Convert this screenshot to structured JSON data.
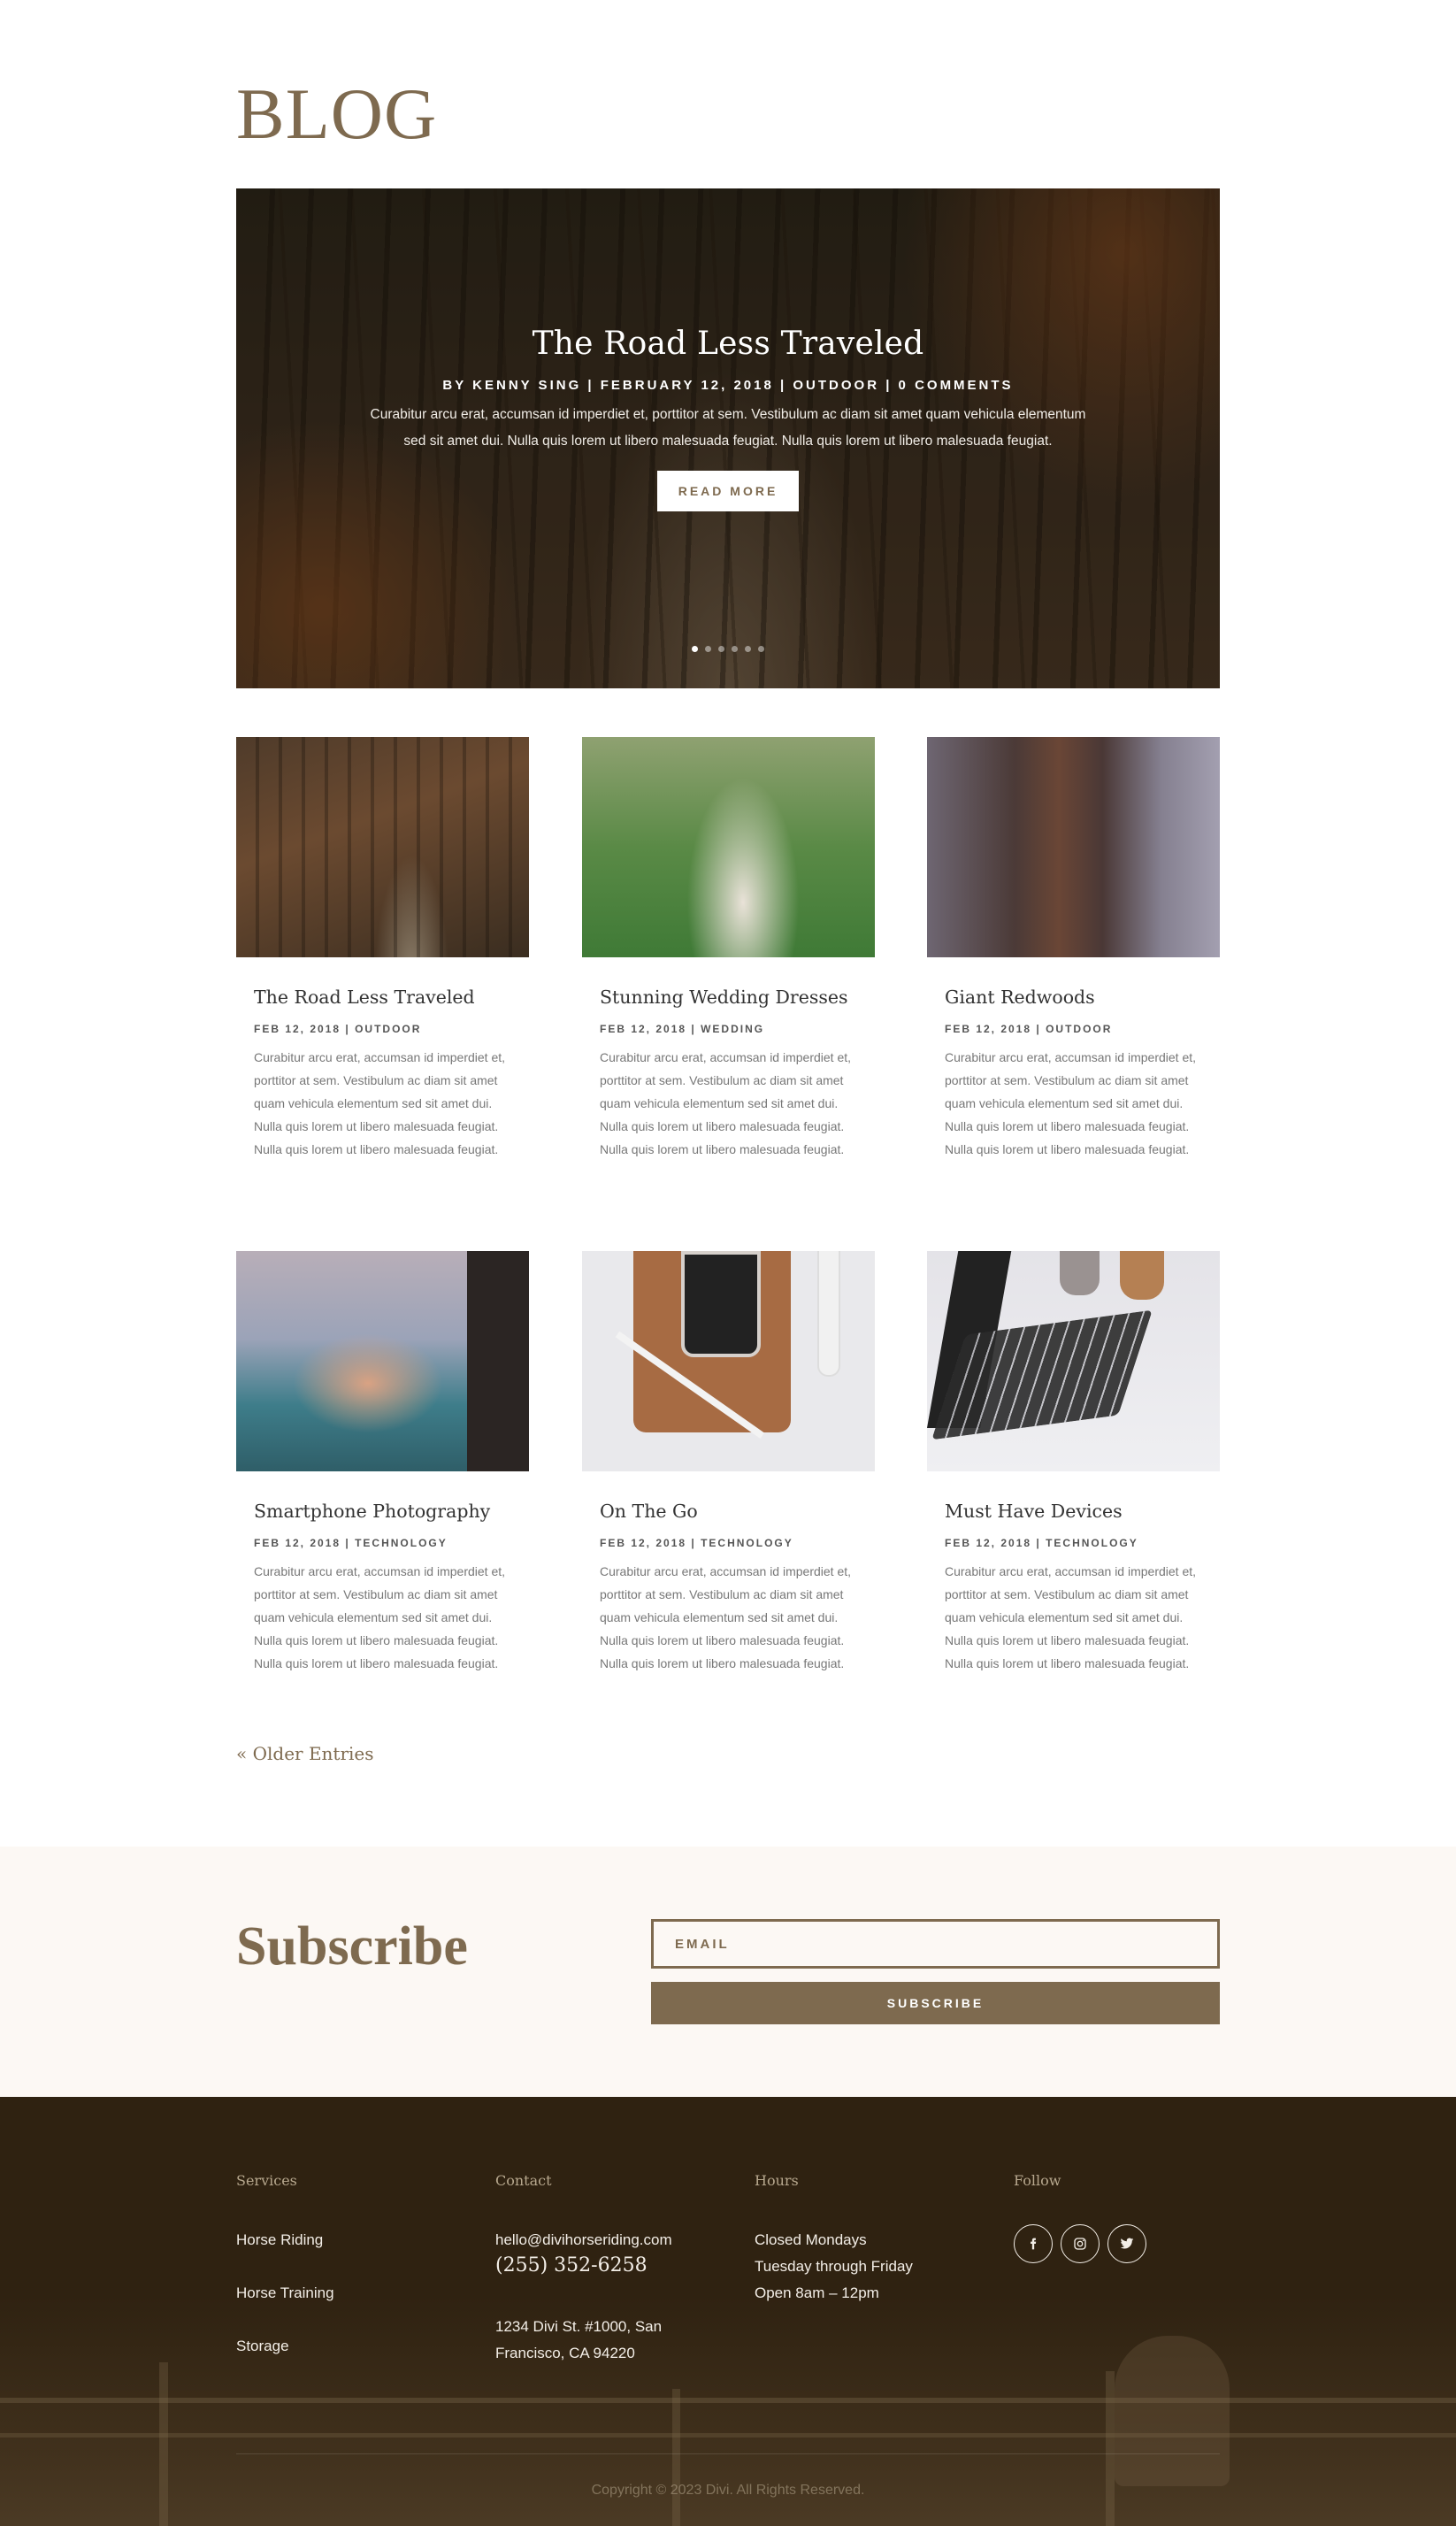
{
  "page": {
    "title": "BLOG"
  },
  "hero": {
    "title": "The Road Less Traveled",
    "meta": "BY KENNY SING | FEBRUARY 12, 2018 | OUTDOOR | 0 COMMENTS",
    "excerpt": "Curabitur arcu erat, accumsan id imperdiet et, porttitor at sem. Vestibulum ac diam sit amet quam vehicula elementum sed sit amet dui. Nulla quis lorem ut libero malesuada feugiat. Nulla quis lorem ut libero malesuada feugiat.",
    "button": "READ MORE",
    "slide_count": 6,
    "active_slide": 1
  },
  "posts": [
    {
      "title": "The Road Less Traveled",
      "meta": "FEB 12, 2018 | OUTDOOR",
      "excerpt": "Curabitur arcu erat, accumsan id imperdiet et, porttitor at sem. Vestibulum ac diam sit amet quam vehicula elementum sed sit amet dui. Nulla quis lorem ut libero malesuada feugiat. Nulla quis lorem ut libero malesuada feugiat."
    },
    {
      "title": "Stunning Wedding Dresses",
      "meta": "FEB 12, 2018 | WEDDING",
      "excerpt": "Curabitur arcu erat, accumsan id imperdiet et, porttitor at sem. Vestibulum ac diam sit amet quam vehicula elementum sed sit amet dui. Nulla quis lorem ut libero malesuada feugiat. Nulla quis lorem ut libero malesuada feugiat."
    },
    {
      "title": "Giant Redwoods",
      "meta": "FEB 12, 2018 | OUTDOOR",
      "excerpt": "Curabitur arcu erat, accumsan id imperdiet et, porttitor at sem. Vestibulum ac diam sit amet quam vehicula elementum sed sit amet dui. Nulla quis lorem ut libero malesuada feugiat. Nulla quis lorem ut libero malesuada feugiat."
    },
    {
      "title": "Smartphone Photography",
      "meta": "FEB 12, 2018 | TECHNOLOGY",
      "excerpt": "Curabitur arcu erat, accumsan id imperdiet et, porttitor at sem. Vestibulum ac diam sit amet quam vehicula elementum sed sit amet dui. Nulla quis lorem ut libero malesuada feugiat. Nulla quis lorem ut libero malesuada feugiat."
    },
    {
      "title": "On The Go",
      "meta": "FEB 12, 2018 | TECHNOLOGY",
      "excerpt": "Curabitur arcu erat, accumsan id imperdiet et, porttitor at sem. Vestibulum ac diam sit amet quam vehicula elementum sed sit amet dui. Nulla quis lorem ut libero malesuada feugiat. Nulla quis lorem ut libero malesuada feugiat."
    },
    {
      "title": "Must Have Devices",
      "meta": "FEB 12, 2018 | TECHNOLOGY",
      "excerpt": "Curabitur arcu erat, accumsan id imperdiet et, porttitor at sem. Vestibulum ac diam sit amet quam vehicula elementum sed sit amet dui. Nulla quis lorem ut libero malesuada feugiat. Nulla quis lorem ut libero malesuada feugiat."
    }
  ],
  "pagination": {
    "older": "« Older Entries"
  },
  "subscribe": {
    "title": "Subscribe",
    "email_placeholder": "EMAIL",
    "button": "SUBSCRIBE"
  },
  "footer": {
    "services": {
      "heading": "Services",
      "items": [
        "Horse Riding",
        "Horse Training",
        "Storage"
      ]
    },
    "contact": {
      "heading": "Contact",
      "email": "hello@divihorseriding.com",
      "phone": "(255) 352-6258",
      "address_line1": "1234 Divi St. #1000, San",
      "address_line2": "Francisco, CA 94220"
    },
    "hours": {
      "heading": "Hours",
      "line1": "Closed Mondays",
      "line2": "Tuesday through Friday",
      "line3": "Open 8am – 12pm"
    },
    "follow": {
      "heading": "Follow",
      "icons": [
        "facebook-icon",
        "instagram-icon",
        "twitter-icon"
      ]
    },
    "copyright": "Copyright © 2023 Divi. All Rights Reserved."
  },
  "colors": {
    "accent": "#7e6a4f",
    "subscribe_bg": "#fcf8f4",
    "footer_bg": "#2f2211"
  }
}
